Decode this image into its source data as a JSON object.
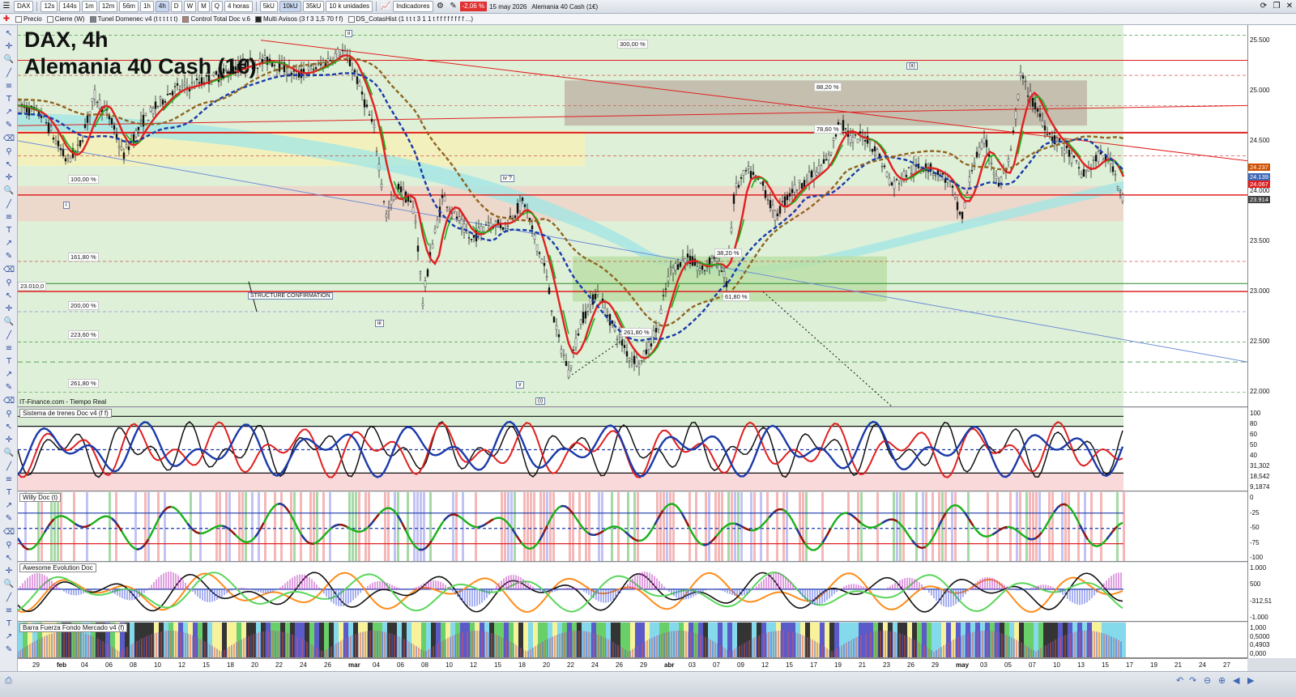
{
  "toolbar": {
    "symbol": "DAX",
    "timeframes": [
      "12s",
      "144s",
      "1m",
      "12m",
      "56m",
      "1h",
      "4h",
      "D",
      "W",
      "M",
      "Q"
    ],
    "timeframe_selected": "4h",
    "period_select": "4 horas",
    "volume_buttons": [
      "5kU",
      "10kU",
      "35kU"
    ],
    "volume_selected": "10kU",
    "units_select": "10 k unidades",
    "indicators_label": "Indicadores",
    "change": "-2,06 %",
    "date": "15 may 2026",
    "instrument": "Alemania 40 Cash (1€)"
  },
  "legend_bar": {
    "items": [
      "Precio",
      "Cierre (W)",
      "Tunel Domenec v4 (t t t t t t)",
      "Control Total Doc v.6",
      "Multi Avisos (3 f 3 1,5 70 f f)",
      "DS_CotasHist (1 t t t 3 1 1 t f f f f f f f f ...)"
    ],
    "item_colors": [
      "#ffffff",
      "#ffffff",
      "#7a7f8c",
      "#b0847a",
      "#222222",
      "#ffffff"
    ]
  },
  "main_chart": {
    "title_line1": "DAX, 4h",
    "title_line2": "Alemania 40 Cash (1€)",
    "source": "IT-Finance.com - Tiempo Real",
    "price_ticks": [
      "25.500",
      "25.000",
      "24.500",
      "24.000",
      "23.500",
      "23.000",
      "22.500",
      "22.000"
    ],
    "price_tags": [
      {
        "text": "24.237",
        "color": "#d05000"
      },
      {
        "text": "24.139",
        "color": "#3f67b5"
      },
      {
        "text": "24.067",
        "color": "#e02020"
      },
      {
        "text": "23.914",
        "color": "#444444"
      }
    ],
    "fib_labels": [
      "300,00 %",
      "88,20 %",
      "100,00 %",
      "161,80 %",
      "23.010,0",
      "200,00 %",
      "223,60 %",
      "261,80 %",
      "78,60 %",
      "38,20 %",
      "61,80 %",
      "261,80 %"
    ],
    "wave_labels": [
      "ii",
      "(ii)",
      "iv ?",
      "i",
      "iii",
      "v",
      "(i)"
    ],
    "structure_label": "STRUCTURE CONFIRMATION"
  },
  "indicators": [
    {
      "name": "Sistema de trenes Doc v4 (f f)",
      "ticks": [
        "100",
        "80",
        "60",
        "50",
        "40",
        "31,302",
        "18,542",
        "9,1874"
      ]
    },
    {
      "name": "Willy Doc (t)",
      "ticks": [
        "0",
        "-25",
        "-50",
        "-75",
        "-100"
      ]
    },
    {
      "name": "Awesome Evolution Doc",
      "ticks": [
        "1.000",
        "500",
        "-312,51",
        "-1.000"
      ]
    },
    {
      "name": "Barra Fuerza Fondo Mercado v4 (f)",
      "ticks": [
        "1,000",
        "0,5000",
        "0,4903",
        "0,000"
      ]
    }
  ],
  "x_axis": {
    "labels": [
      "29",
      "feb",
      "04",
      "06",
      "08",
      "10",
      "12",
      "15",
      "18",
      "20",
      "22",
      "24",
      "26",
      "mar",
      "04",
      "06",
      "08",
      "10",
      "12",
      "15",
      "18",
      "20",
      "22",
      "24",
      "26",
      "29",
      "abr",
      "03",
      "07",
      "09",
      "12",
      "15",
      "17",
      "19",
      "21",
      "23",
      "26",
      "29",
      "may",
      "03",
      "05",
      "07",
      "10",
      "13",
      "15",
      "17",
      "19",
      "21",
      "24",
      "27"
    ],
    "month_labels": [
      "feb",
      "mar",
      "abr",
      "may"
    ]
  },
  "icons": {
    "left_tools": [
      "cursor-icon",
      "crosshair-icon",
      "zoom-icon",
      "line-icon",
      "fib-icon",
      "text-icon",
      "trend-icon",
      "pencil-icon",
      "eraser-icon",
      "magnet-icon"
    ],
    "top_right": [
      "refresh-icon",
      "window-icon",
      "close-icon"
    ]
  },
  "colors": {
    "bull": "#19b019",
    "bear": "#e02020",
    "trend_blue": "#1a3aa8",
    "brown": "#8f6420",
    "bg_green": "#dff0d8"
  }
}
